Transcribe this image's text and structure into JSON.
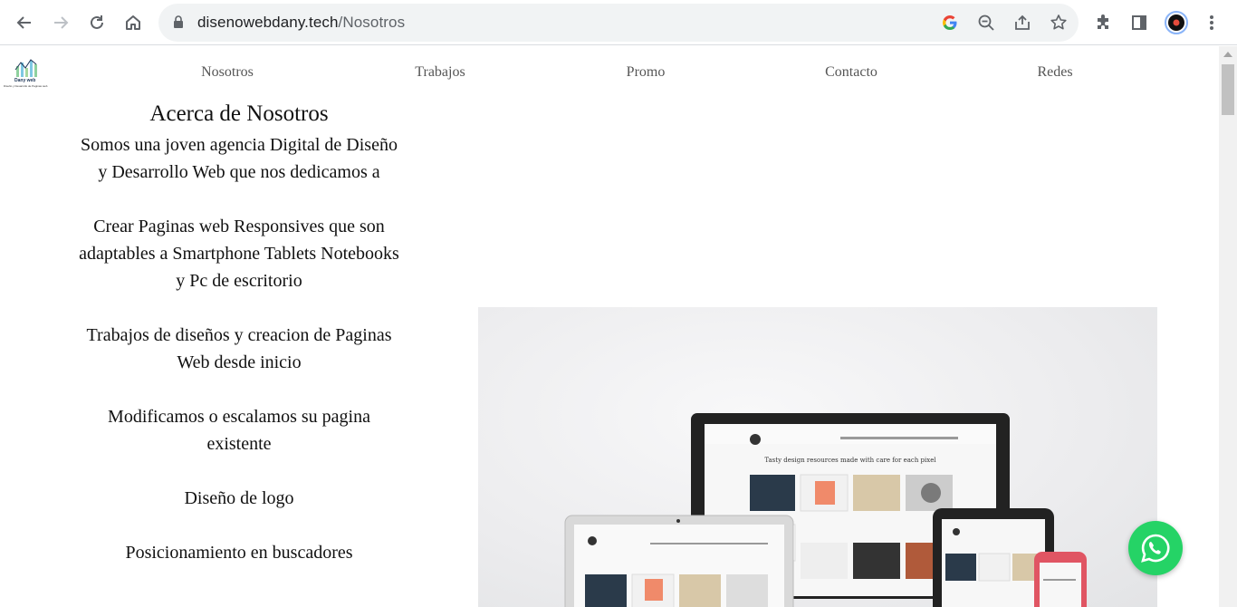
{
  "browser": {
    "url_domain": "disenowebdany.tech",
    "url_path": "/Nosotros",
    "icons": [
      "back-icon",
      "forward-icon",
      "reload-icon",
      "home-icon",
      "lock-icon",
      "google-icon",
      "zoom-out-icon",
      "share-icon",
      "bookmark-star-icon",
      "extensions-icon",
      "side-panel-icon",
      "profile-avatar",
      "kebab-menu-icon"
    ]
  },
  "logo": {
    "name": "Dany web",
    "tagline": "Diseño y Desarrollo de Paginas web"
  },
  "nav": {
    "items": [
      "Nosotros",
      "Trabajos",
      "Promo",
      "Contacto",
      "Redes"
    ]
  },
  "about": {
    "title": "Acerca de Nosotros",
    "paragraphs": [
      "Somos una joven agencia Digital de Diseño y Desarrollo Web que nos dedicamos a",
      "Crear Paginas web Responsives que son adaptables a Smartphone Tablets Notebooks y Pc de escritorio",
      "Trabajos de diseños y creacion de Paginas Web desde inicio",
      "Modificamos o escalamos su pagina existente",
      "Diseño de logo",
      "Posicionamiento en buscadores"
    ]
  },
  "hero": {
    "mockup_heading": "Tasty design resources made with care for each pixel"
  },
  "colors": {
    "whatsapp": "#25d366",
    "text": "#111111",
    "nav_text": "#555555",
    "chrome_bar": "#f1f3f4"
  }
}
